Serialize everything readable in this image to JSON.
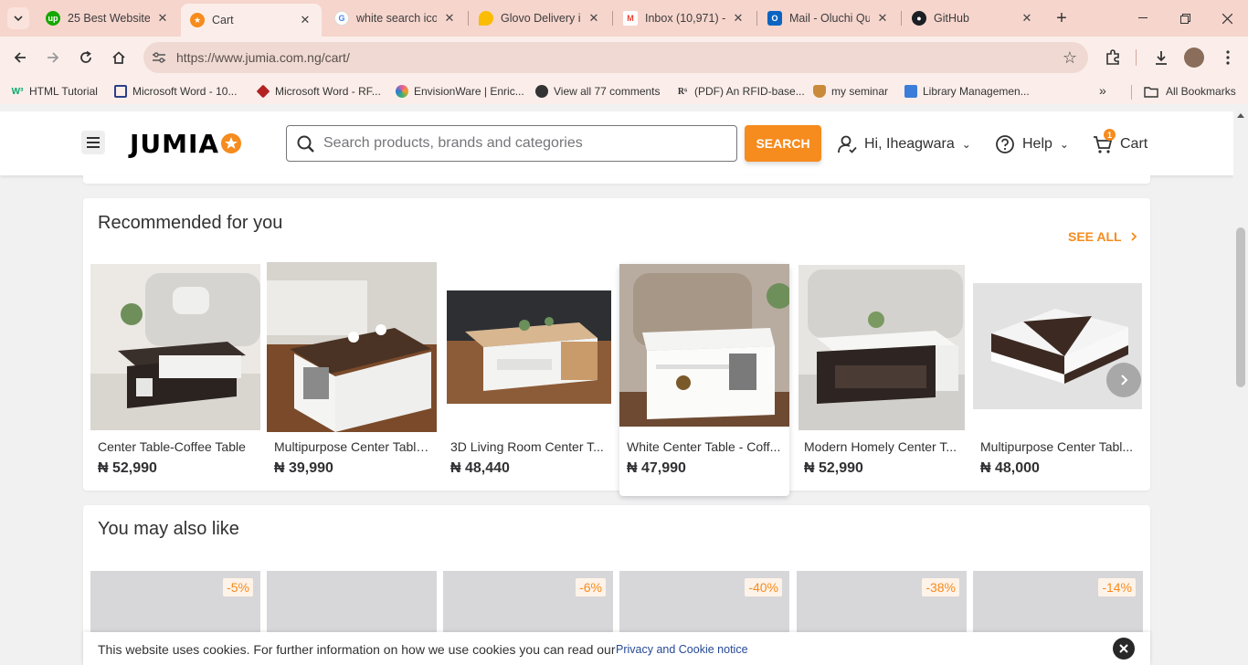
{
  "browser": {
    "tabs": [
      {
        "title": "25 Best Website",
        "icon": "upwork-icon",
        "color": "#14a800"
      },
      {
        "title": "Cart",
        "icon": "jumia-star-icon",
        "color": "#f68b1e",
        "active": true
      },
      {
        "title": "white search ico",
        "icon": "google-icon",
        "color": "#4285f4"
      },
      {
        "title": "Glovo Delivery in",
        "icon": "maps-pin-icon",
        "color": "#fbbc04"
      },
      {
        "title": "Inbox (10,971) -",
        "icon": "gmail-icon",
        "color": "#ea4335"
      },
      {
        "title": "Mail - Oluchi Qu",
        "icon": "outlook-icon",
        "color": "#0a64c0"
      },
      {
        "title": "GitHub",
        "icon": "github-icon",
        "color": "#1b1f23"
      }
    ],
    "url": "https://www.jumia.com.ng/cart/",
    "bookmarks": [
      {
        "label": "HTML Tutorial",
        "icon": "w3schools-icon",
        "color": "#04aa6d"
      },
      {
        "label": "Microsoft Word - 10...",
        "icon": "grid-doc-icon",
        "color": "#2b3f8a"
      },
      {
        "label": "Microsoft Word - RF...",
        "icon": "diamond-doc-icon",
        "color": "#b22222"
      },
      {
        "label": "EnvisionWare | Enric...",
        "icon": "envisionware-icon",
        "color": "#e65c9c"
      },
      {
        "label": "View all 77 comments",
        "icon": "globe-icon",
        "color": "#333333"
      },
      {
        "label": "(PDF) An RFID-base...",
        "icon": "researchgate-icon",
        "color": "#333333"
      },
      {
        "label": "my seminar",
        "icon": "seminar-icon",
        "color": "#b5651d"
      },
      {
        "label": "Library Managemen...",
        "icon": "library-icon",
        "color": "#3b7dd8"
      }
    ],
    "all_bookmarks_label": "All Bookmarks"
  },
  "header": {
    "logo_text": "JUMIA",
    "search_placeholder": "Search products, brands and categories",
    "search_button": "SEARCH",
    "account_label": "Hi, Iheagwara",
    "help_label": "Help",
    "cart_label": "Cart",
    "cart_count": "1"
  },
  "recommended": {
    "title": "Recommended for you",
    "see_all": "SEE ALL",
    "products": [
      {
        "name": "Center Table-Coffee Table",
        "price": "₦ 52,990"
      },
      {
        "name": "Multipurpose Center Table...",
        "price": "₦ 39,990"
      },
      {
        "name": "3D Living Room Center T...",
        "price": "₦ 48,440"
      },
      {
        "name": "White Center Table - Coff...",
        "price": "₦ 47,990"
      },
      {
        "name": "Modern Homely Center T...",
        "price": "₦ 52,990"
      },
      {
        "name": "Multipurpose Center Tabl...",
        "price": "₦ 48,000"
      }
    ]
  },
  "also_like": {
    "title": "You may also like",
    "discounts": [
      "-5%",
      "",
      "-6%",
      "-40%",
      "-38%",
      "-14%"
    ]
  },
  "cookie_banner": {
    "text": "This website uses cookies. For further information on how we use cookies you can read our",
    "link": "Privacy and Cookie notice"
  },
  "colors": {
    "accent": "#f68b1e",
    "tabstrip": "#f6d5cd"
  }
}
